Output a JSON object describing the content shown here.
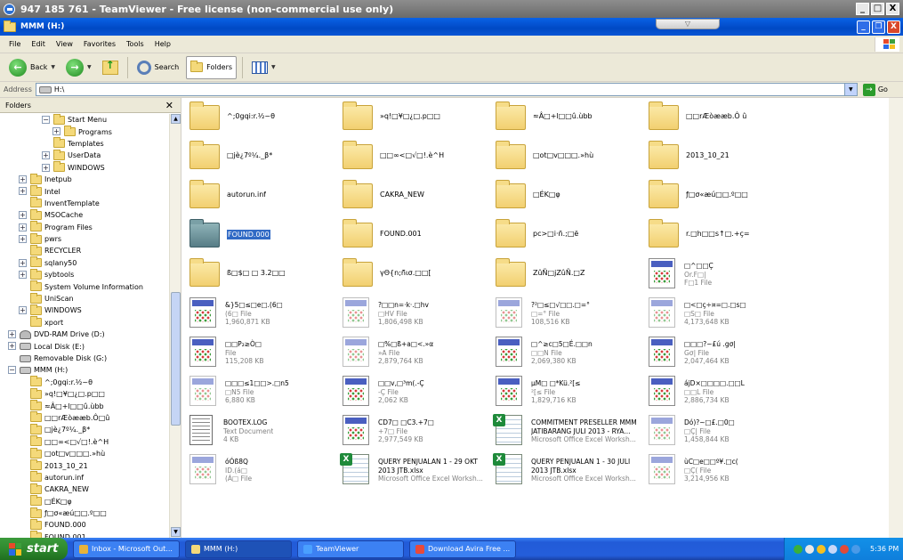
{
  "teamviewer": {
    "title": "947 185 761 - TeamViewer - Free license (non-commercial use only)",
    "tab_arrow": "▽",
    "min": "_",
    "max": "□",
    "close": "X"
  },
  "window": {
    "title": "MMM (H:)",
    "min": "_",
    "max": "❐",
    "close": "X"
  },
  "menu": [
    "File",
    "Edit",
    "View",
    "Favorites",
    "Tools",
    "Help"
  ],
  "toolbar": {
    "back": "Back",
    "forward_arrow": "→",
    "back_arrow": "←",
    "dropdown": "▼",
    "search": "Search",
    "folders": "Folders"
  },
  "address": {
    "label": "Address",
    "value": "H:\\",
    "go": "Go",
    "go_arrow": "→",
    "dropdown": "▼"
  },
  "sidebar": {
    "title": "Folders",
    "close": "✕",
    "expand": "+",
    "collapse": "−",
    "items": [
      {
        "label": "Start Menu",
        "indent": 3,
        "toggle": "−",
        "icon": "folder"
      },
      {
        "label": "Programs",
        "indent": 4,
        "toggle": "+",
        "icon": "folder"
      },
      {
        "label": "Templates",
        "indent": 3,
        "toggle": "",
        "icon": "folder"
      },
      {
        "label": "UserData",
        "indent": 3,
        "toggle": "+",
        "icon": "folder"
      },
      {
        "label": "WINDOWS",
        "indent": 3,
        "toggle": "+",
        "icon": "folder"
      },
      {
        "label": "Inetpub",
        "indent": 1,
        "toggle": "+",
        "icon": "folder"
      },
      {
        "label": "Intel",
        "indent": 1,
        "toggle": "+",
        "icon": "folder"
      },
      {
        "label": "InventTemplate",
        "indent": 1,
        "toggle": "",
        "icon": "folder"
      },
      {
        "label": "MSOCache",
        "indent": 1,
        "toggle": "+",
        "icon": "folder"
      },
      {
        "label": "Program Files",
        "indent": 1,
        "toggle": "+",
        "icon": "folder"
      },
      {
        "label": "pwrs",
        "indent": 1,
        "toggle": "+",
        "icon": "folder"
      },
      {
        "label": "RECYCLER",
        "indent": 1,
        "toggle": "",
        "icon": "folder"
      },
      {
        "label": "sqlany50",
        "indent": 1,
        "toggle": "+",
        "icon": "folder"
      },
      {
        "label": "sybtools",
        "indent": 1,
        "toggle": "+",
        "icon": "folder"
      },
      {
        "label": "System Volume Information",
        "indent": 1,
        "toggle": "",
        "icon": "folder"
      },
      {
        "label": "UniScan",
        "indent": 1,
        "toggle": "",
        "icon": "folder"
      },
      {
        "label": "WINDOWS",
        "indent": 1,
        "toggle": "+",
        "icon": "folder"
      },
      {
        "label": "xport",
        "indent": 1,
        "toggle": "",
        "icon": "folder"
      },
      {
        "label": "DVD-RAM Drive (D:)",
        "indent": 0,
        "toggle": "+",
        "icon": "dvd"
      },
      {
        "label": "Local Disk (E:)",
        "indent": 0,
        "toggle": "+",
        "icon": "drive"
      },
      {
        "label": "Removable Disk (G:)",
        "indent": 0,
        "toggle": "",
        "icon": "drive"
      },
      {
        "label": "MMM (H:)",
        "indent": 0,
        "toggle": "−",
        "icon": "drive"
      },
      {
        "label": "^;0gqi:r.½~θ",
        "indent": 1,
        "toggle": "",
        "icon": "folder"
      },
      {
        "label": "»q!□¥□¿□.p□□",
        "indent": 1,
        "toggle": "",
        "icon": "folder"
      },
      {
        "label": "≈Â□+l□□û.ùbb",
        "indent": 1,
        "toggle": "",
        "icon": "folder"
      },
      {
        "label": "□□rÆòææb.Ô□û",
        "indent": 1,
        "toggle": "",
        "icon": "folder"
      },
      {
        "label": "□jè¿7º¼._β*",
        "indent": 1,
        "toggle": "",
        "icon": "folder"
      },
      {
        "label": "□□∞<□√□!.è^H",
        "indent": 1,
        "toggle": "",
        "icon": "folder"
      },
      {
        "label": "□ot□v□□□.»hù",
        "indent": 1,
        "toggle": "",
        "icon": "folder"
      },
      {
        "label": "2013_10_21",
        "indent": 1,
        "toggle": "",
        "icon": "folder"
      },
      {
        "label": "autorun.inf",
        "indent": 1,
        "toggle": "",
        "icon": "folder"
      },
      {
        "label": "CAKRA_NEW",
        "indent": 1,
        "toggle": "",
        "icon": "folder"
      },
      {
        "label": "□ÉK□φ",
        "indent": 1,
        "toggle": "",
        "icon": "folder"
      },
      {
        "label": "ƒ□σ«æú□□.º□□",
        "indent": 1,
        "toggle": "",
        "icon": "folder"
      },
      {
        "label": "FOUND.000",
        "indent": 1,
        "toggle": "",
        "icon": "folder"
      },
      {
        "label": "FOUND.001",
        "indent": 1,
        "toggle": "",
        "icon": "folder"
      }
    ]
  },
  "files": [
    {
      "name": "^;0gqi:r.½~θ",
      "type": "folder"
    },
    {
      "name": "»q!□¥□¿□.p□□",
      "type": "folder"
    },
    {
      "name": "≈Â□+l□□û.ùbb",
      "type": "folder"
    },
    {
      "name": "□□rÆòææb.Ô û",
      "type": "folder"
    },
    {
      "name": "□jè¿7º¼._β*",
      "type": "folder"
    },
    {
      "name": "□□∞<□√□!.è^H",
      "type": "folder"
    },
    {
      "name": "□ot□v□□□.»hù",
      "type": "folder"
    },
    {
      "name": "2013_10_21",
      "type": "folder"
    },
    {
      "name": "autorun.inf",
      "type": "folder"
    },
    {
      "name": "CAKRA_NEW",
      "type": "folder"
    },
    {
      "name": "□ÉK□φ",
      "type": "folder"
    },
    {
      "name": "ƒ□σ«æú□□.º□□",
      "type": "folder"
    },
    {
      "name": "FOUND.000",
      "type": "folder",
      "selected": true
    },
    {
      "name": "FOUND.001",
      "type": "folder"
    },
    {
      "name": "pc>□i·ñ.;□ë",
      "type": "folder"
    },
    {
      "name": "r.□h□□s↑□.+ç=",
      "type": "folder"
    },
    {
      "name": "ß□$□ □ 3.2□□",
      "type": "folder"
    },
    {
      "name": "γΘ{n;ñ̃ισ.□□[",
      "type": "folder"
    },
    {
      "name": "ZûÑ□jZûÑ.□Z",
      "type": "folder"
    },
    {
      "name": "□^□□Ç",
      "l2": "Or.F□|",
      "l3": "F□1 File",
      "type": "doc"
    },
    {
      "name": "&}5□≤□e□.(6□",
      "l2": "(6□ File",
      "l3": "1,960,871 KB",
      "type": "doc"
    },
    {
      "name": "?□□n=·k·.□hv",
      "l2": "□HV File",
      "l3": "1,806,498 KB",
      "type": "docdim"
    },
    {
      "name": "?²□≤□√□□.□=°",
      "l2": "□=° File",
      "l3": "108,516 KB",
      "type": "docdim"
    },
    {
      "name": "□<□ç÷¤=□.□s□",
      "l2": "□S□ File",
      "l3": "4,173,648 KB",
      "type": "docdim"
    },
    {
      "name": "□□P₂≥Ò□",
      "l2": "File",
      "l3": "115,208 KB",
      "type": "doc"
    },
    {
      "name": "□%□ß+a□<.»α",
      "l2": "»A File",
      "l3": "2,879,764 KB",
      "type": "docdim"
    },
    {
      "name": "□^≥c□5□É.□□n",
      "l2": "□□N File",
      "l3": "2,069,380 KB",
      "type": "doc"
    },
    {
      "name": "□□□?~£ú .gσ|",
      "l2": "Gσ| File",
      "l3": "2,047,464 KB",
      "type": "doc"
    },
    {
      "name": "□□□≤1□□>.□n5",
      "l2": "□N5 File",
      "l3": "6,880 KB",
      "type": "docdim"
    },
    {
      "name": "□□v,□³m(.-Ç",
      "l2": "-Ç File",
      "l3": "2,062 KB",
      "type": "doc"
    },
    {
      "name": "µM□ □*Kü.²[≤",
      "l2": "²[≤ File",
      "l3": "1,829,716 KB",
      "type": "doc"
    },
    {
      "name": "ájD×□□□□.□□L",
      "l2": "□□L File",
      "l3": "2,886,734 KB",
      "type": "doc"
    },
    {
      "name": "BOOTEX.LOG",
      "l2": "Text Document",
      "l3": "4 KB",
      "type": "txt"
    },
    {
      "name": "CD7□ □C3.+7□",
      "l2": "+7□ File",
      "l3": "2,977,549 KB",
      "type": "doc"
    },
    {
      "name": "COMMITMENT PRESELLER MMM",
      "l2": "JATIBARANG JULI 2013 - RYA...",
      "l3": "Microsoft Office Excel Worksh...",
      "type": "xls"
    },
    {
      "name": "Dó)?~□£.□0□",
      "l2": "□Ç| File",
      "l3": "1,458,844 KB",
      "type": "docdim"
    },
    {
      "name": "óÓß8Q",
      "l2": "ID.(á□",
      "l3": "(Á□ File",
      "type": "docdim"
    },
    {
      "name": "QUERY PENJUALAN 1 - 29 OKT",
      "l2": "2013 JTB.xlsx",
      "l3": "Microsoft Office Excel Worksh...",
      "type": "xls"
    },
    {
      "name": "QUERY PENJUALAN 1 - 30 JULI",
      "l2": "2013 JTB.xlsx",
      "l3": "Microsoft Office Excel Worksh...",
      "type": "xls"
    },
    {
      "name": "ùC□e□□º¥.□c(",
      "l2": "□Ç( File",
      "l3": "3,214,956 KB",
      "type": "docdim"
    }
  ],
  "taskbar": {
    "start": "start",
    "buttons": [
      {
        "label": "Inbox - Microsoft Out...",
        "color": "#e8b33a"
      },
      {
        "label": "MMM (H:)",
        "color": "#f4d97a",
        "active": true
      },
      {
        "label": "TeamViewer",
        "color": "#4aa0ff"
      },
      {
        "label": "Download Avira Free ...",
        "color": "#e84a3a"
      }
    ],
    "clock": "5:36 PM"
  }
}
